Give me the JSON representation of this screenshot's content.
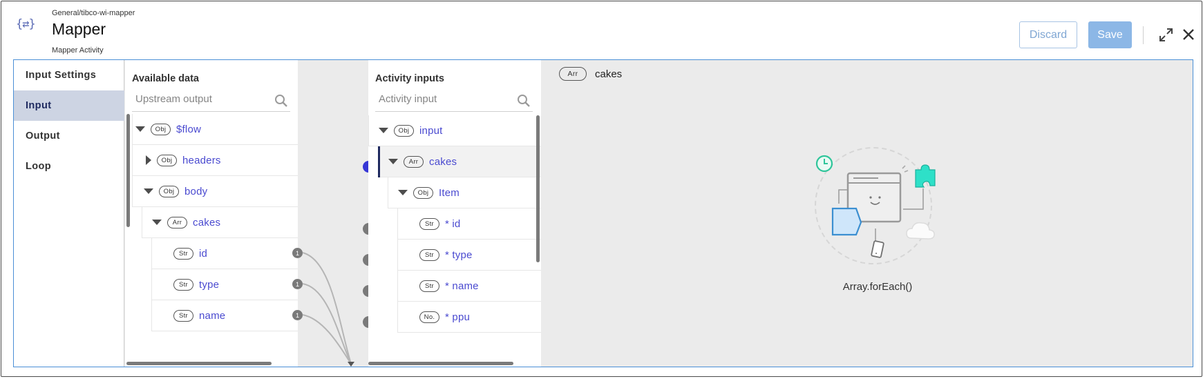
{
  "header": {
    "path": "General/tibco-wi-mapper",
    "title": "Mapper",
    "subtitle": "Mapper Activity",
    "icon": "mapper-icon",
    "discard_label": "Discard",
    "save_label": "Save"
  },
  "tabs": [
    {
      "label": "Input Settings",
      "active": false
    },
    {
      "label": "Input",
      "active": true
    },
    {
      "label": "Output",
      "active": false
    },
    {
      "label": "Loop",
      "active": false
    }
  ],
  "available": {
    "title": "Available data",
    "search_placeholder": "Upstream output",
    "items": [
      {
        "type": "Obj",
        "name": "$flow",
        "caret": "down"
      },
      {
        "type": "Obj",
        "name": "headers",
        "caret": "right"
      },
      {
        "type": "Obj",
        "name": "body",
        "caret": "down"
      },
      {
        "type": "Arr",
        "name": "cakes",
        "caret": "down"
      },
      {
        "type": "Str",
        "name": "id",
        "count": "1"
      },
      {
        "type": "Str",
        "name": "type",
        "count": "1"
      },
      {
        "type": "Str",
        "name": "name",
        "count": "1"
      }
    ]
  },
  "inputs": {
    "title": "Activity inputs",
    "search_placeholder": "Activity input",
    "items": [
      {
        "type": "Obj",
        "name": "input",
        "caret": "down"
      },
      {
        "type": "Arr",
        "name": "cakes",
        "caret": "down",
        "selected": true
      },
      {
        "type": "Obj",
        "name": "Item",
        "caret": "down"
      },
      {
        "type": "Str",
        "name": "* id"
      },
      {
        "type": "Str",
        "name": "* type"
      },
      {
        "type": "Str",
        "name": "* name"
      },
      {
        "type": "No.",
        "name": "* ppu"
      }
    ]
  },
  "detail": {
    "type": "Arr",
    "name": "cakes",
    "illustration_label": "Array.forEach()"
  },
  "colors": {
    "accent": "#4a4ad0",
    "active_dot": "#3737d6",
    "save_bg": "#8cb7e6",
    "tab_active_bg": "#cdd4e3",
    "teal": "#2ee0c8",
    "blue_panel": "#cfe6fa"
  }
}
